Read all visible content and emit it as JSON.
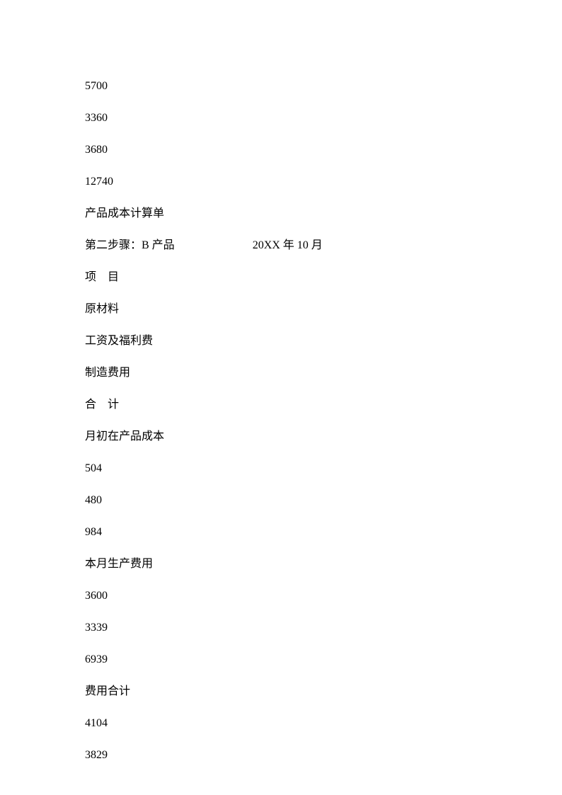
{
  "lines": {
    "v1": "5700",
    "v2": "3360",
    "v3": "3680",
    "v4": "12740",
    "title": "产品成本计算单",
    "step_label": "第二步骤：B 产品",
    "step_date": "20XX 年 10 月",
    "item_header": "项　目",
    "raw_material": "原材料",
    "wages": "工资及福利费",
    "manufacturing": "制造费用",
    "total": "合　计",
    "opening_wip": "月初在产品成本",
    "o1": "504",
    "o2": "480",
    "o3": "984",
    "current_month": "本月生产费用",
    "c1": "3600",
    "c2": "3339",
    "c3": "6939",
    "cost_total": "费用合计",
    "t1": "4104",
    "t2": "3829"
  }
}
